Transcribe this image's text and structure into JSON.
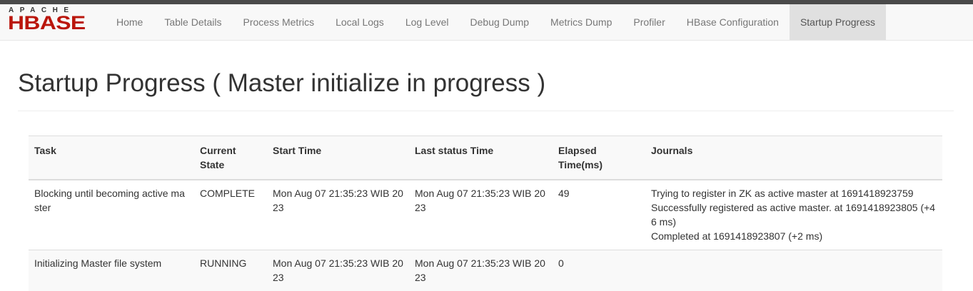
{
  "brand": {
    "top": "APACHE",
    "name": "HBASE"
  },
  "nav": {
    "items": [
      {
        "label": "Home"
      },
      {
        "label": "Table Details"
      },
      {
        "label": "Process Metrics"
      },
      {
        "label": "Local Logs"
      },
      {
        "label": "Log Level"
      },
      {
        "label": "Debug Dump"
      },
      {
        "label": "Metrics Dump"
      },
      {
        "label": "Profiler"
      },
      {
        "label": "HBase Configuration"
      },
      {
        "label": "Startup Progress"
      }
    ],
    "active": "Startup Progress"
  },
  "page": {
    "title": "Startup Progress ( Master initialize in progress )"
  },
  "table": {
    "headers": {
      "task": "Task",
      "state": "Current State",
      "start": "Start Time",
      "last": "Last status Time",
      "elapsed": "Elapsed Time(ms)",
      "journals": "Journals"
    },
    "rows": [
      {
        "task": "Blocking until becoming active master",
        "state": "COMPLETE",
        "start": "Mon Aug 07 21:35:23 WIB 2023",
        "last": "Mon Aug 07 21:35:23 WIB 2023",
        "elapsed": "49",
        "journals": [
          "Trying to register in ZK as active master at 1691418923759",
          "Successfully registered as active master. at 1691418923805 (+46 ms)",
          "Completed at 1691418923807 (+2 ms)"
        ]
      },
      {
        "task": "Initializing Master file system",
        "state": "RUNNING",
        "start": "Mon Aug 07 21:35:23 WIB 2023",
        "last": "Mon Aug 07 21:35:23 WIB 2023",
        "elapsed": "0",
        "journals": []
      }
    ]
  }
}
